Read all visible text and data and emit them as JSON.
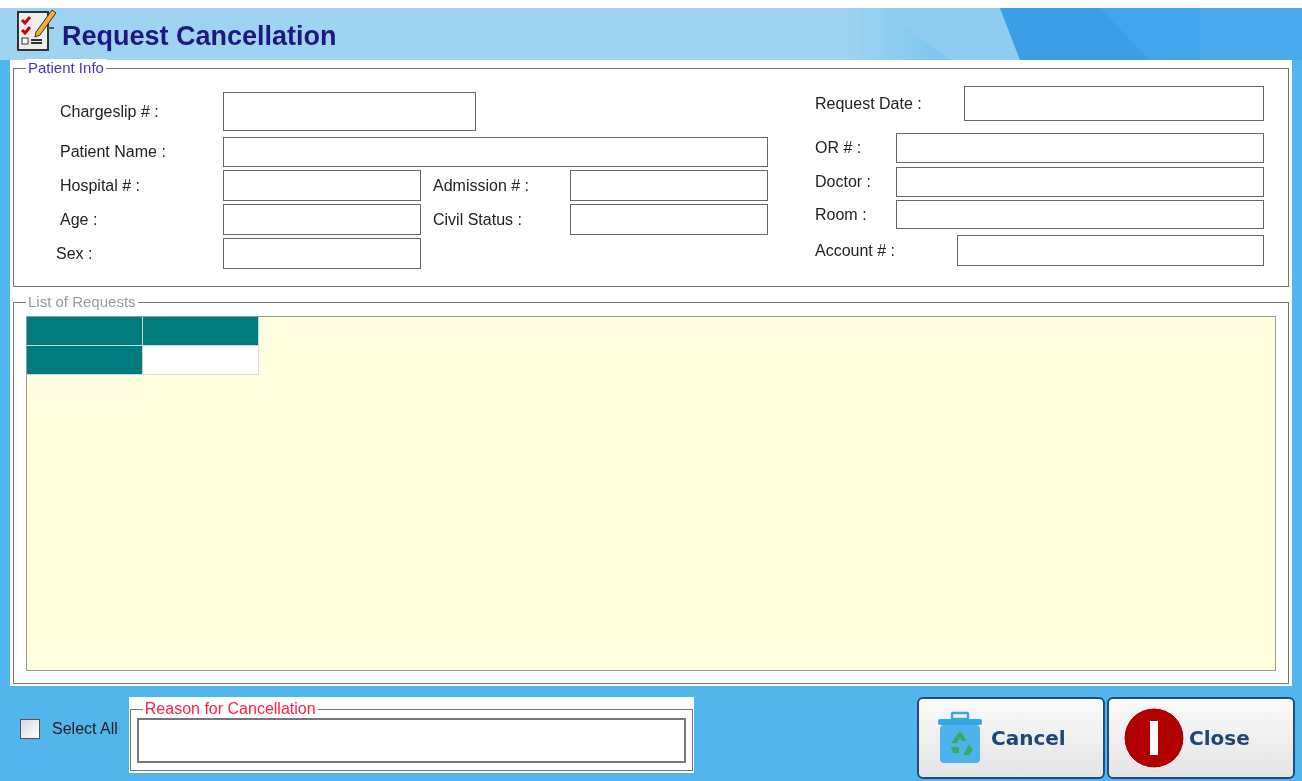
{
  "window": {
    "title": "Request Cancellation"
  },
  "patient_info": {
    "title": "Patient Info",
    "left_fields": [
      {
        "label": "Chargeslip # :"
      },
      {
        "label": "Patient Name :"
      },
      {
        "label": "Hospital # :"
      },
      {
        "label": "Admission # :"
      },
      {
        "label": "Age :"
      },
      {
        "label": "Civil Status :"
      },
      {
        "label": "Sex :"
      }
    ],
    "right_fields": [
      {
        "label": "Request Date :"
      },
      {
        "label": "OR # :"
      },
      {
        "label": "Doctor :"
      },
      {
        "label": "Room :"
      },
      {
        "label": "Account # :"
      }
    ]
  },
  "list_of_requests": {
    "title": "List of Requests",
    "grid_rows": [
      {
        "cells": [
          {
            "kind": "fixed"
          },
          {
            "kind": "fixed"
          }
        ]
      },
      {
        "cells": [
          {
            "kind": "fixed"
          },
          {
            "kind": "empty"
          }
        ]
      }
    ]
  },
  "select_all": {
    "label": "Select All",
    "checked": false
  },
  "reason": {
    "title": "Reason for Cancellation"
  },
  "buttons": [
    {
      "label": "Cancel",
      "kind": "recycle"
    },
    {
      "label": "Close",
      "kind": "stop"
    }
  ]
}
